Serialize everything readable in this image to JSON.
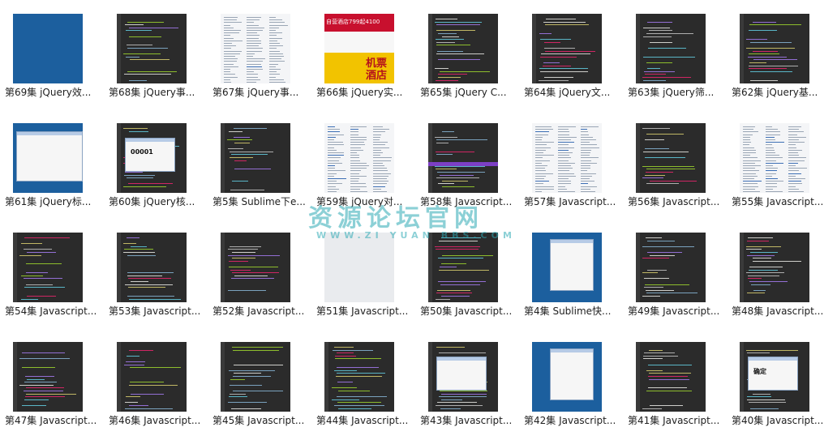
{
  "watermark": {
    "main": "资源论坛官网",
    "sub": "WWW.ZI YUAN BBS.COM"
  },
  "tiles": [
    {
      "label": "第69集 jQuery效...",
      "thumb": "blue"
    },
    {
      "label": "第68集 jQuery事...",
      "thumb": "code"
    },
    {
      "label": "第67集 jQuery事...",
      "thumb": "list"
    },
    {
      "label": "第66集 jQuery实...",
      "thumb": "shop",
      "badge": "机票酒店",
      "banner": "自营酒店799起4100"
    },
    {
      "label": "第65集 jQuery C...",
      "thumb": "code"
    },
    {
      "label": "第64集 jQuery文...",
      "thumb": "code"
    },
    {
      "label": "第63集 jQuery筛...",
      "thumb": "code"
    },
    {
      "label": "第62集 jQuery基...",
      "thumb": "code"
    },
    {
      "label": "第61集 jQuery标...",
      "thumb": "browser"
    },
    {
      "label": "第60集 jQuery核...",
      "thumb": "code-win",
      "code": "00001"
    },
    {
      "label": "第5集 Sublime下e...",
      "thumb": "code"
    },
    {
      "label": "第59集 jQuery对...",
      "thumb": "list"
    },
    {
      "label": "第58集 Javascript...",
      "thumb": "code-hl"
    },
    {
      "label": "第57集 Javascript...",
      "thumb": "list"
    },
    {
      "label": "第56集 Javascript...",
      "thumb": "code"
    },
    {
      "label": "第55集 Javascript...",
      "thumb": "list"
    },
    {
      "label": "第54集 Javascript...",
      "thumb": "code"
    },
    {
      "label": "第53集 Javascript...",
      "thumb": "code"
    },
    {
      "label": "第52集 Javascript...",
      "thumb": "code"
    },
    {
      "label": "第51集 Javascript...",
      "thumb": "light"
    },
    {
      "label": "第50集 Javascript...",
      "thumb": "code"
    },
    {
      "label": "第4集 Sublime快...",
      "thumb": "blue-win"
    },
    {
      "label": "第49集 Javascript...",
      "thumb": "code"
    },
    {
      "label": "第48集 Javascript...",
      "thumb": "code"
    },
    {
      "label": "第47集 Javascript...",
      "thumb": "code"
    },
    {
      "label": "第46集 Javascript...",
      "thumb": "code"
    },
    {
      "label": "第45集 Javascript...",
      "thumb": "code"
    },
    {
      "label": "第44集 Javascript...",
      "thumb": "code"
    },
    {
      "label": "第43集 Javascript...",
      "thumb": "code-win"
    },
    {
      "label": "第42集 Javascript...",
      "thumb": "blue-win"
    },
    {
      "label": "第41集 Javascript...",
      "thumb": "code"
    },
    {
      "label": "第40集 Javascript...",
      "thumb": "code-win",
      "code": "确定"
    }
  ]
}
